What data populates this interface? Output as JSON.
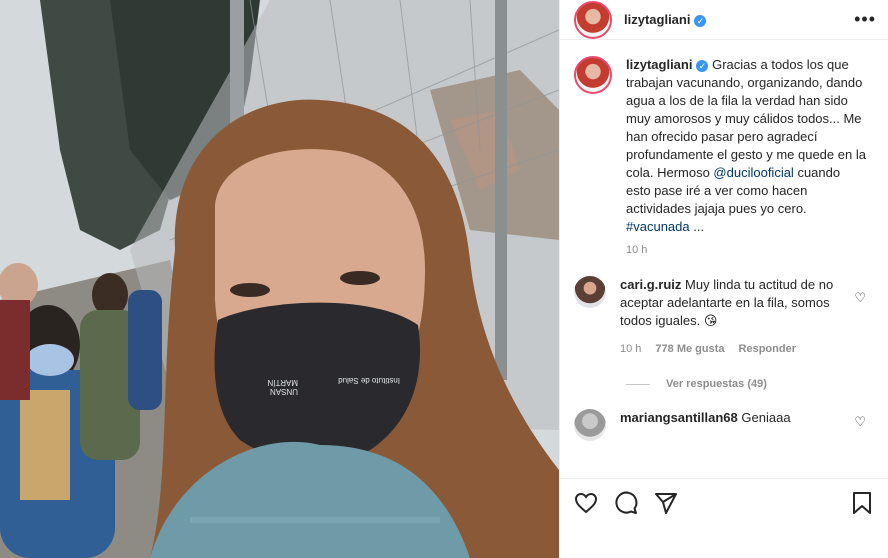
{
  "post": {
    "username": "lizytagliani",
    "verified_icon": "verified-badge-icon",
    "more_icon": "more-options-icon"
  },
  "caption": {
    "username": "lizytagliani",
    "text_before": "Gracias a todos los que trabajan vacunando, organizando, dando agua a los de la fila la verdad han sido muy amorosos y muy cálidos todos... Me han ofrecido pasar pero agradecí profundamente el gesto y me quede en la cola. Hermoso ",
    "mention": "@ducilooficial",
    "text_after": " cuando esto pase iré a ver como hacen actividades jajaja pues yo cero. ",
    "hashtag": "#vacunada",
    "ellipsis": " ...",
    "time": "10 h"
  },
  "comments": [
    {
      "username": "cari.g.ruiz",
      "text": "Muy linda tu actitud de no aceptar adelantarte en la fila, somos todos iguales. 😘",
      "time": "10 h",
      "likes": "778 Me gusta",
      "reply_label": "Responder",
      "view_replies": "Ver respuestas (49)"
    },
    {
      "username": "mariangsantillan68",
      "text": "Geniaaa"
    }
  ],
  "mask": {
    "brand_left": "UNSAN MARTÍN",
    "brand_right": "Instituto de Salud"
  },
  "colors": {
    "link": "#00376b",
    "verified": "#3897f0",
    "meta": "#8e8e8e"
  }
}
